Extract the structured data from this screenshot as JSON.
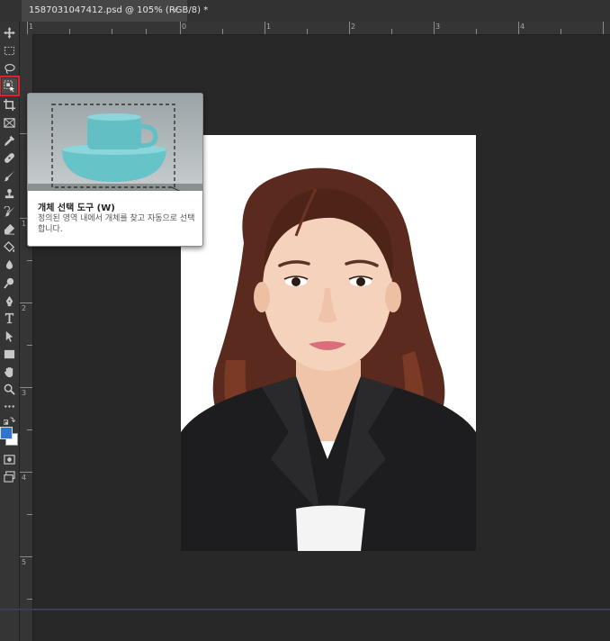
{
  "document_tab": {
    "title": "1587031047412.psd @ 105% (RGB/8) *",
    "close": "×"
  },
  "toolbar": {
    "tools": [
      {
        "name": "move-tool",
        "icon": "move-icon"
      },
      {
        "name": "marquee-tool",
        "icon": "marquee-icon"
      },
      {
        "name": "lasso-tool",
        "icon": "lasso-icon"
      },
      {
        "name": "object-selection-tool",
        "icon": "object-selection-icon",
        "active": true
      },
      {
        "name": "crop-tool",
        "icon": "crop-icon"
      },
      {
        "name": "frame-tool",
        "icon": "frame-icon"
      },
      {
        "name": "eyedropper-tool",
        "icon": "eyedropper-icon"
      },
      {
        "name": "healing-brush-tool",
        "icon": "bandage-icon"
      },
      {
        "name": "brush-tool",
        "icon": "brush-icon"
      },
      {
        "name": "clone-stamp-tool",
        "icon": "stamp-icon"
      },
      {
        "name": "history-brush-tool",
        "icon": "history-brush-icon"
      },
      {
        "name": "eraser-tool",
        "icon": "eraser-icon"
      },
      {
        "name": "paint-bucket-tool",
        "icon": "bucket-icon"
      },
      {
        "name": "blur-tool",
        "icon": "drop-icon"
      },
      {
        "name": "dodge-tool",
        "icon": "dodge-icon"
      },
      {
        "name": "pen-tool",
        "icon": "pen-icon"
      },
      {
        "name": "type-tool",
        "icon": "type-icon"
      },
      {
        "name": "path-selection-tool",
        "icon": "arrow-icon"
      },
      {
        "name": "rectangle-tool",
        "icon": "rectangle-icon"
      },
      {
        "name": "hand-tool",
        "icon": "hand-icon"
      },
      {
        "name": "zoom-tool",
        "icon": "zoom-icon"
      },
      {
        "name": "more-tools",
        "icon": "ellipsis-icon"
      }
    ],
    "foreground_color": "#2f74d0",
    "background_color": "#ffffff"
  },
  "rulers": {
    "top_labels": [
      "1",
      "0",
      "1",
      "2",
      "3",
      "4"
    ],
    "left_labels": [
      "1",
      "2",
      "3",
      "4",
      "5"
    ]
  },
  "tooltip": {
    "title": "개체 선택 도구 (W)",
    "description": "정의된 영역 내에서 개체를 찾고 자동으로 선택합니다."
  }
}
